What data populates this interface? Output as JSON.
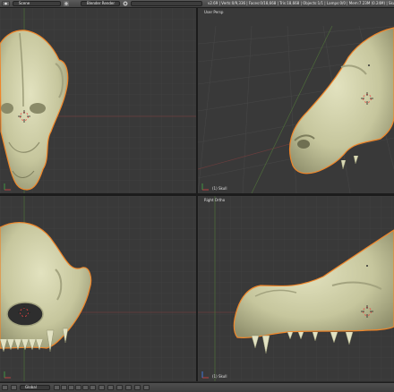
{
  "header": {
    "scene_field": "Scene",
    "render_engine": "Blender Render",
    "stats": "v2.69 | Verts:0/9,336 | Faces:0/18,668 | Tris:18,668 | Objects:1/1 | Lamps:0/0 | Mem:7.23M (0.24M) | Skull"
  },
  "viewports": {
    "top_left": {
      "label": "",
      "object": ""
    },
    "top_right": {
      "label": "User Persp",
      "object": "(1) Skull"
    },
    "bottom_left": {
      "label": "",
      "object": ""
    },
    "bottom_right": {
      "label": "Right Ortho",
      "object": "(1) Skull"
    }
  },
  "footer": {
    "orientation": "Global"
  },
  "colors": {
    "background": "#2b2b2b",
    "viewport": "#393939",
    "skull": "#cfcfa8",
    "selection_outline": "#f0862a"
  }
}
